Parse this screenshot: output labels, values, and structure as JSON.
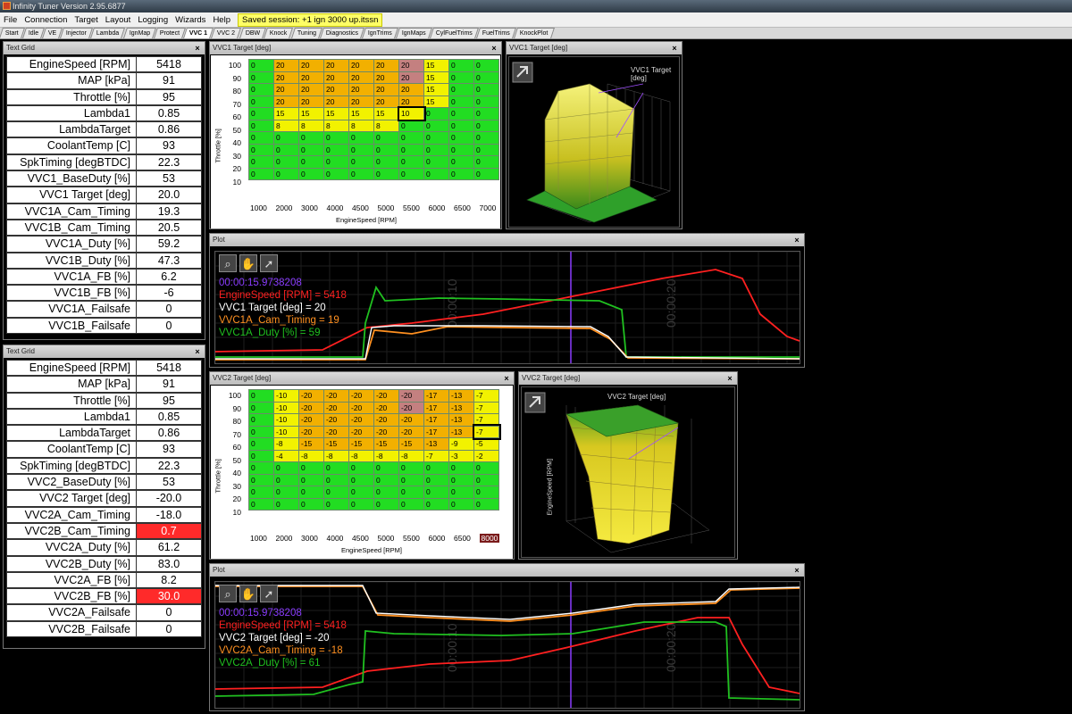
{
  "app": {
    "title": "Infinity Tuner Version 2.95.6877"
  },
  "menu": {
    "items": [
      "File",
      "Connection",
      "Target",
      "Layout",
      "Logging",
      "Wizards",
      "Help"
    ],
    "saved_session": "Saved session: +1 ign 3000 up.itssn"
  },
  "tabs": [
    "Start",
    "Idle",
    "VE",
    "Injector",
    "Lambda",
    "IgnMap",
    "Protect",
    "VVC 1",
    "VVC 2",
    "DBW",
    "Knock",
    "Tuning",
    "Diagnostics",
    "IgnTrims",
    "IgnMaps",
    "CylFuelTrims",
    "FuelTrims",
    "KnockPlot"
  ],
  "active_tab": "VVC 1",
  "textgrid1": {
    "title": "Text Grid",
    "rows": [
      {
        "label": "EngineSpeed [RPM]",
        "value": "5418"
      },
      {
        "label": "MAP [kPa]",
        "value": "91"
      },
      {
        "label": "Throttle [%]",
        "value": "95"
      },
      {
        "label": "Lambda1",
        "value": "0.85"
      },
      {
        "label": "LambdaTarget",
        "value": "0.86"
      },
      {
        "label": "CoolantTemp [C]",
        "value": "93"
      },
      {
        "label": "SpkTiming [degBTDC]",
        "value": "22.3"
      },
      {
        "label": "VVC1_BaseDuty [%]",
        "value": "53"
      },
      {
        "label": "VVC1 Target [deg]",
        "value": "20.0"
      },
      {
        "label": "VVC1A_Cam_Timing",
        "value": "19.3"
      },
      {
        "label": "VVC1B_Cam_Timing",
        "value": "20.5"
      },
      {
        "label": "VVC1A_Duty [%]",
        "value": "59.2"
      },
      {
        "label": "VVC1B_Duty [%]",
        "value": "47.3"
      },
      {
        "label": "VVC1A_FB [%]",
        "value": "6.2"
      },
      {
        "label": "VVC1B_FB [%]",
        "value": "-6"
      },
      {
        "label": "VVC1A_Failsafe",
        "value": "0"
      },
      {
        "label": "VVC1B_Failsafe",
        "value": "0"
      }
    ]
  },
  "textgrid2": {
    "title": "Text Grid",
    "rows": [
      {
        "label": "EngineSpeed [RPM]",
        "value": "5418"
      },
      {
        "label": "MAP [kPa]",
        "value": "91"
      },
      {
        "label": "Throttle [%]",
        "value": "95"
      },
      {
        "label": "Lambda1",
        "value": "0.85"
      },
      {
        "label": "LambdaTarget",
        "value": "0.86"
      },
      {
        "label": "CoolantTemp [C]",
        "value": "93"
      },
      {
        "label": "SpkTiming [degBTDC]",
        "value": "22.3"
      },
      {
        "label": "VVC2_BaseDuty [%]",
        "value": "53"
      },
      {
        "label": "VVC2 Target [deg]",
        "value": "-20.0"
      },
      {
        "label": "VVC2A_Cam_Timing",
        "value": "-18.0"
      },
      {
        "label": "VVC2B_Cam_Timing",
        "value": "0.7",
        "alert": true
      },
      {
        "label": "VVC2A_Duty [%]",
        "value": "61.2"
      },
      {
        "label": "VVC2B_Duty [%]",
        "value": "83.0"
      },
      {
        "label": "VVC2A_FB [%]",
        "value": "8.2"
      },
      {
        "label": "VVC2B_FB [%]",
        "value": "30.0",
        "alert": true
      },
      {
        "label": "VVC2A_Failsafe",
        "value": "0"
      },
      {
        "label": "VVC2B_Failsafe",
        "value": "0"
      }
    ]
  },
  "vvc1_table": {
    "title": "VVC1 Target [deg]",
    "y_label": "Throttle [%]",
    "x_label": "EngineSpeed [RPM]",
    "rows": [
      "100",
      "90",
      "80",
      "70",
      "60",
      "50",
      "40",
      "30",
      "20",
      "10"
    ],
    "cols": [
      "1000",
      "2000",
      "3000",
      "4000",
      "4500",
      "5000",
      "5500",
      "6000",
      "6500",
      "7000"
    ],
    "cells": [
      [
        "0",
        "20",
        "20",
        "20",
        "20",
        "20",
        "20",
        "15",
        "0",
        "0"
      ],
      [
        "0",
        "20",
        "20",
        "20",
        "20",
        "20",
        "20",
        "15",
        "0",
        "0"
      ],
      [
        "0",
        "20",
        "20",
        "20",
        "20",
        "20",
        "20",
        "15",
        "0",
        "0"
      ],
      [
        "0",
        "20",
        "20",
        "20",
        "20",
        "20",
        "20",
        "15",
        "0",
        "0"
      ],
      [
        "0",
        "15",
        "15",
        "15",
        "15",
        "15",
        "10",
        "0",
        "0",
        "0"
      ],
      [
        "0",
        "8",
        "8",
        "8",
        "8",
        "8",
        "0",
        "0",
        "0",
        "0"
      ],
      [
        "0",
        "0",
        "0",
        "0",
        "0",
        "0",
        "0",
        "0",
        "0",
        "0"
      ],
      [
        "0",
        "0",
        "0",
        "0",
        "0",
        "0",
        "0",
        "0",
        "0",
        "0"
      ],
      [
        "0",
        "0",
        "0",
        "0",
        "0",
        "0",
        "0",
        "0",
        "0",
        "0"
      ],
      [
        "0",
        "0",
        "0",
        "0",
        "0",
        "0",
        "0",
        "0",
        "0",
        "0"
      ]
    ]
  },
  "vvc2_table": {
    "title": "VVC2 Target [deg]",
    "y_label": "Throttle [%]",
    "x_label": "EngineSpeed [RPM]",
    "rows": [
      "100",
      "90",
      "80",
      "70",
      "60",
      "50",
      "40",
      "30",
      "20",
      "10"
    ],
    "cols": [
      "1000",
      "2000",
      "3000",
      "4000",
      "4500",
      "5000",
      "5500",
      "6000",
      "6500",
      "8000"
    ],
    "cells": [
      [
        "0",
        "-10",
        "-20",
        "-20",
        "-20",
        "-20",
        "-20",
        "-17",
        "-13",
        "-7"
      ],
      [
        "0",
        "-10",
        "-20",
        "-20",
        "-20",
        "-20",
        "-20",
        "-17",
        "-13",
        "-7"
      ],
      [
        "0",
        "-10",
        "-20",
        "-20",
        "-20",
        "-20",
        "-20",
        "-17",
        "-13",
        "-7"
      ],
      [
        "0",
        "-10",
        "-20",
        "-20",
        "-20",
        "-20",
        "-20",
        "-17",
        "-13",
        "-7"
      ],
      [
        "0",
        "-8",
        "-15",
        "-15",
        "-15",
        "-15",
        "-15",
        "-13",
        "-9",
        "-5"
      ],
      [
        "0",
        "-4",
        "-8",
        "-8",
        "-8",
        "-8",
        "-8",
        "-7",
        "-3",
        "-2"
      ],
      [
        "0",
        "0",
        "0",
        "0",
        "0",
        "0",
        "0",
        "0",
        "0",
        "0"
      ],
      [
        "0",
        "0",
        "0",
        "0",
        "0",
        "0",
        "0",
        "0",
        "0",
        "0"
      ],
      [
        "0",
        "0",
        "0",
        "0",
        "0",
        "0",
        "0",
        "0",
        "0",
        "0"
      ],
      [
        "0",
        "0",
        "0",
        "0",
        "0",
        "0",
        "0",
        "0",
        "0",
        "0"
      ]
    ]
  },
  "surface1": {
    "title": "VVC1 Target [deg]",
    "label": "VVC1 Target [deg]"
  },
  "surface2": {
    "title": "VVC2 Target [deg]",
    "label": "VVC2 Target [deg]",
    "axis": "EngineSpeed [RPM]"
  },
  "plot1": {
    "title": "Plot",
    "time": "00:00:15.9738208",
    "tick1": "00:00:10",
    "tick2": "00:00:20",
    "legend": [
      {
        "text": "EngineSpeed [RPM] = 5418",
        "color": "#ff2020"
      },
      {
        "text": "VVC1 Target [deg] = 20",
        "color": "#ffffff"
      },
      {
        "text": "VVC1A_Cam_Timing = 19",
        "color": "#ff9020"
      },
      {
        "text": "VVC1A_Duty [%] = 59",
        "color": "#20c020"
      }
    ]
  },
  "plot2": {
    "title": "Plot",
    "time": "00:00:15.9738208",
    "tick1": "00:00:10",
    "tick2": "00:00:20",
    "legend": [
      {
        "text": "EngineSpeed [RPM] = 5418",
        "color": "#ff2020"
      },
      {
        "text": "VVC2 Target [deg] = -20",
        "color": "#ffffff"
      },
      {
        "text": "VVC2A_Cam_Timing = -18",
        "color": "#ff9020"
      },
      {
        "text": "VVC2A_Duty [%] = 61",
        "color": "#20c020"
      }
    ]
  },
  "colors": {
    "time_cursor": "#8a3cff",
    "grid_green": "#22dd22",
    "grid_yellow": "#f2f200",
    "grid_orange": "#f2b000",
    "alert_red": "#ff2a2a"
  }
}
